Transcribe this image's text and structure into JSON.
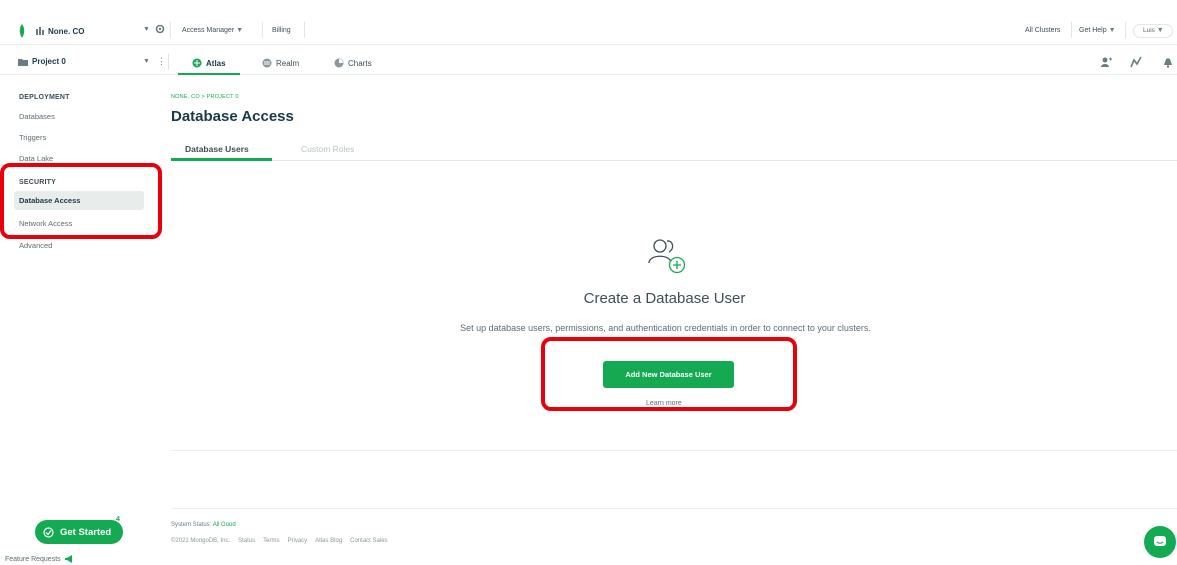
{
  "header": {
    "org_name": "None. CO",
    "links": {
      "access_manager": "Access Manager",
      "billing": "Billing",
      "all_clusters": "All Clusters",
      "get_help": "Get Help",
      "user": "Luis"
    }
  },
  "project_bar": {
    "project_name": "Project 0",
    "tabs": [
      {
        "label": "Atlas",
        "active": true
      },
      {
        "label": "Realm",
        "active": false
      },
      {
        "label": "Charts",
        "active": false
      }
    ]
  },
  "sidebar": {
    "deployment_heading": "DEPLOYMENT",
    "deployment_items": [
      "Databases",
      "Triggers",
      "Data Lake"
    ],
    "security_heading": "SECURITY",
    "security_items": [
      "Database Access",
      "Network Access",
      "Advanced"
    ],
    "active_item": "Database Access"
  },
  "main": {
    "breadcrumb": "NONE. CO > PROJECT 0",
    "title": "Database Access",
    "tabs": [
      {
        "label": "Database Users",
        "active": true
      },
      {
        "label": "Custom Roles",
        "active": false
      }
    ],
    "empty_state": {
      "title": "Create a Database User",
      "description": "Set up database users, permissions, and authentication credentials in order to connect to your clusters.",
      "button_label": "Add New Database User",
      "learn_more": "Learn more"
    }
  },
  "footer": {
    "status_label": "System Status:",
    "status_value": "All Good",
    "copyright": "©2021 MongoDB, Inc.",
    "links": [
      "Status",
      "Terms",
      "Privacy",
      "Atlas Blog",
      "Contact Sales"
    ]
  },
  "floating": {
    "get_started_label": "Get Started",
    "get_started_badge": "4",
    "feature_requests": "Feature Requests"
  },
  "colors": {
    "brand_green": "#13aa52",
    "highlight_red": "#e8000b",
    "text_dark": "#1a3a4a"
  }
}
